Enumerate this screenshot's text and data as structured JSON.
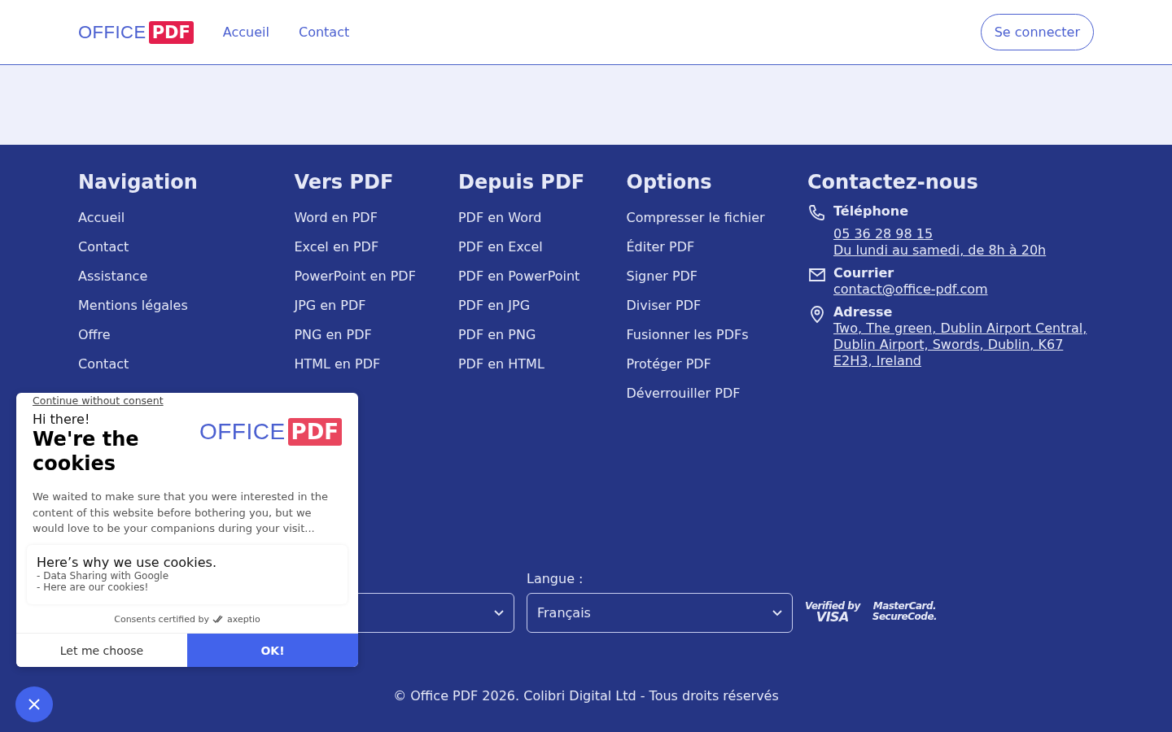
{
  "header": {
    "logo": {
      "word": "OFFICE",
      "badge": "PDF"
    },
    "nav": [
      "Accueil",
      "Contact"
    ],
    "login_button": "Se connecter"
  },
  "footer": {
    "columns": [
      {
        "title": "Navigation",
        "links": [
          "Accueil",
          "Contact",
          "Assistance",
          "Mentions légales",
          "Offre",
          "Contact"
        ]
      },
      {
        "title": "Vers PDF",
        "links": [
          "Word en PDF",
          "Excel en PDF",
          "PowerPoint en PDF",
          "JPG en PDF",
          "PNG en PDF",
          "HTML en PDF"
        ]
      },
      {
        "title": "Depuis PDF",
        "links": [
          "PDF en Word",
          "PDF en Excel",
          "PDF en PowerPoint",
          "PDF en JPG",
          "PDF en PNG",
          "PDF en HTML"
        ]
      },
      {
        "title": "Options",
        "links": [
          "Compresser le fichier",
          "Éditer PDF",
          "Signer PDF",
          "Diviser PDF",
          "Fusionner les PDFs",
          "Protéger PDF",
          "Déverrouiller PDF"
        ]
      }
    ],
    "contact": {
      "title": "Contactez-nous",
      "items": [
        {
          "kind": "phone",
          "label": "Téléphone",
          "lines": [
            "05 36 28 98 15",
            "Du lundi au samedi, de 8h à 20h"
          ]
        },
        {
          "kind": "mail",
          "label": "Courrier",
          "lines": [
            "contact@office-pdf.com"
          ]
        },
        {
          "kind": "address",
          "label": "Adresse",
          "lines": [
            "Two, The green, Dublin Airport Central, Dublin Airport, Swords, Dublin, K67 E2H3, Ireland"
          ]
        }
      ]
    },
    "language": {
      "label": "Langue :",
      "value": "Français"
    },
    "payment_logos": [
      {
        "top": "Verified by",
        "bottom": "VISA"
      },
      {
        "top": "MasterCard.",
        "bottom": "SecureCode."
      }
    ],
    "copyright": "© Office PDF 2026. Colibri Digital Ltd - Tous droits réservés"
  },
  "cookie_banner": {
    "skip_link": "Continue without consent",
    "greeting": "Hi there!",
    "title": "We're the cookies",
    "logo": {
      "word": "OFFICE",
      "badge": "PDF"
    },
    "body": "We waited to make sure that you were interested in the content of this website before bothering you, but we would love to be your companions during your visit...",
    "why": {
      "title": "Here’s why we use cookies.",
      "items": [
        "- Data Sharing with Google",
        "- Here are our cookies!"
      ]
    },
    "certified": {
      "text": "Consents certified by",
      "brand": "axeptio"
    },
    "buttons": [
      "Let me choose",
      "OK!"
    ]
  }
}
